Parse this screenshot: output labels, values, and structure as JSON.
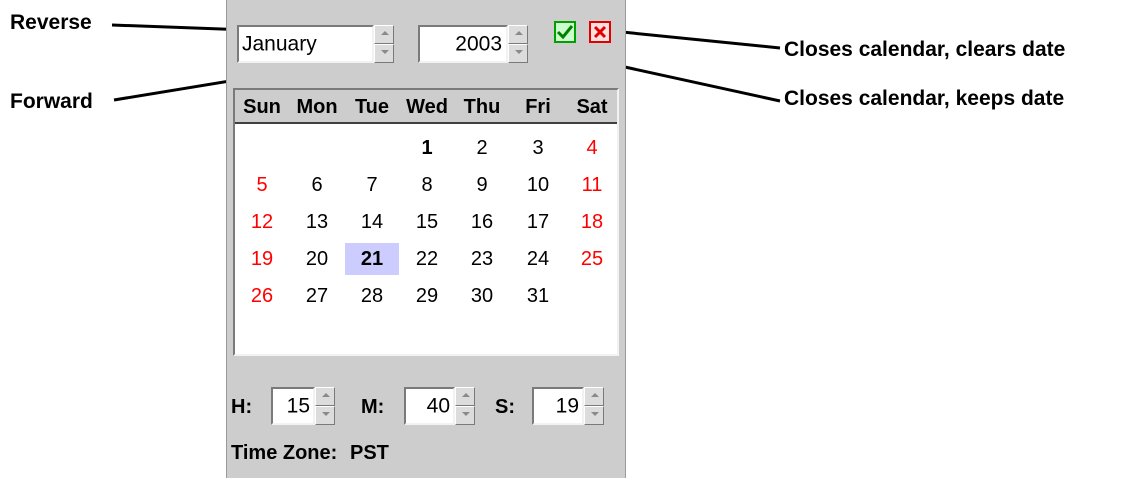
{
  "annotations": {
    "reverse": "Reverse",
    "forward": "Forward",
    "clears": "Closes calendar, clears date",
    "keeps": "Closes calendar, keeps date"
  },
  "calendar": {
    "month": "January",
    "year": "2003",
    "ok_icon": "check-icon",
    "cancel_icon": "x-icon",
    "day_headers": [
      "Sun",
      "Mon",
      "Tue",
      "Wed",
      "Thu",
      "Fri",
      "Sat"
    ],
    "weeks": [
      [
        "",
        "",
        "",
        "1",
        "2",
        "3",
        "4"
      ],
      [
        "5",
        "6",
        "7",
        "8",
        "9",
        "10",
        "11"
      ],
      [
        "12",
        "13",
        "14",
        "15",
        "16",
        "17",
        "18"
      ],
      [
        "19",
        "20",
        "21",
        "22",
        "23",
        "24",
        "25"
      ],
      [
        "26",
        "27",
        "28",
        "29",
        "30",
        "31",
        ""
      ]
    ],
    "selected_day": "21",
    "today": "1",
    "weekend_color": "#ff0000",
    "selected_color": "#ccccff"
  },
  "time": {
    "h_label": "H:",
    "h_value": "15",
    "m_label": "M:",
    "m_value": "40",
    "s_label": "S:",
    "s_value": "19",
    "timezone_label": "Time Zone:",
    "timezone_value": "PST"
  }
}
